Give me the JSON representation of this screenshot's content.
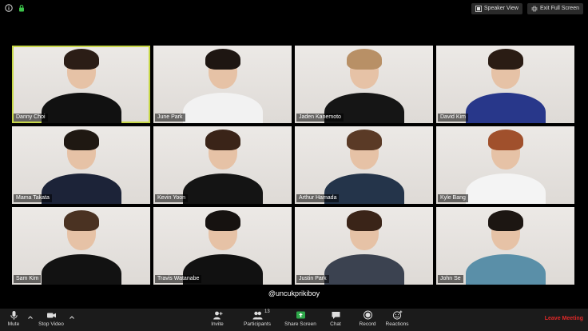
{
  "top_bar": {
    "speaker_view": "Speaker View",
    "exit_full_screen": "Exit Full Screen"
  },
  "participants": [
    {
      "name": "Danny Choi",
      "active": true,
      "shirt": "#111111",
      "hair": "#2b1d16"
    },
    {
      "name": "June Park",
      "active": false,
      "shirt": "#f2f2f2",
      "hair": "#1e1612"
    },
    {
      "name": "Jaden Kanemoto",
      "active": false,
      "shirt": "#151515",
      "hair": "#b89066"
    },
    {
      "name": "David Kim",
      "active": false,
      "shirt": "#28378a",
      "hair": "#2a1c14"
    },
    {
      "name": "Mama Takata",
      "active": false,
      "shirt": "#1c2338",
      "hair": "#1f1812"
    },
    {
      "name": "Kevin Yoon",
      "active": false,
      "shirt": "#141414",
      "hair": "#3a2418"
    },
    {
      "name": "Arthur Hamada",
      "active": false,
      "shirt": "#24344a",
      "hair": "#5a3a26"
    },
    {
      "name": "Kyle Bang",
      "active": false,
      "shirt": "#f4f4f4",
      "hair": "#a0502c"
    },
    {
      "name": "Sam Kim",
      "active": false,
      "shirt": "#121212",
      "hair": "#4a3222"
    },
    {
      "name": "Travis Watanabe",
      "active": false,
      "shirt": "#111111",
      "hair": "#161210"
    },
    {
      "name": "Justin Park",
      "active": false,
      "shirt": "#3b4250",
      "hair": "#3a2418"
    },
    {
      "name": "John Se",
      "active": false,
      "shirt": "#5a8fa8",
      "hair": "#1c1612"
    }
  ],
  "watermark": "@uncukprikiboy",
  "toolbar": {
    "mute": "Mute",
    "stop_video": "Stop Video",
    "invite": "Invite",
    "participants": "Participants",
    "participants_count": "13",
    "share_screen": "Share Screen",
    "chat": "Chat",
    "record": "Record",
    "reactions": "Reactions",
    "leave_meeting": "Leave Meeting"
  },
  "colors": {
    "active_border": "#c8d84a",
    "share_green": "#2ea84a",
    "leave_red": "#e02828",
    "lock_green": "#3cc24a"
  }
}
